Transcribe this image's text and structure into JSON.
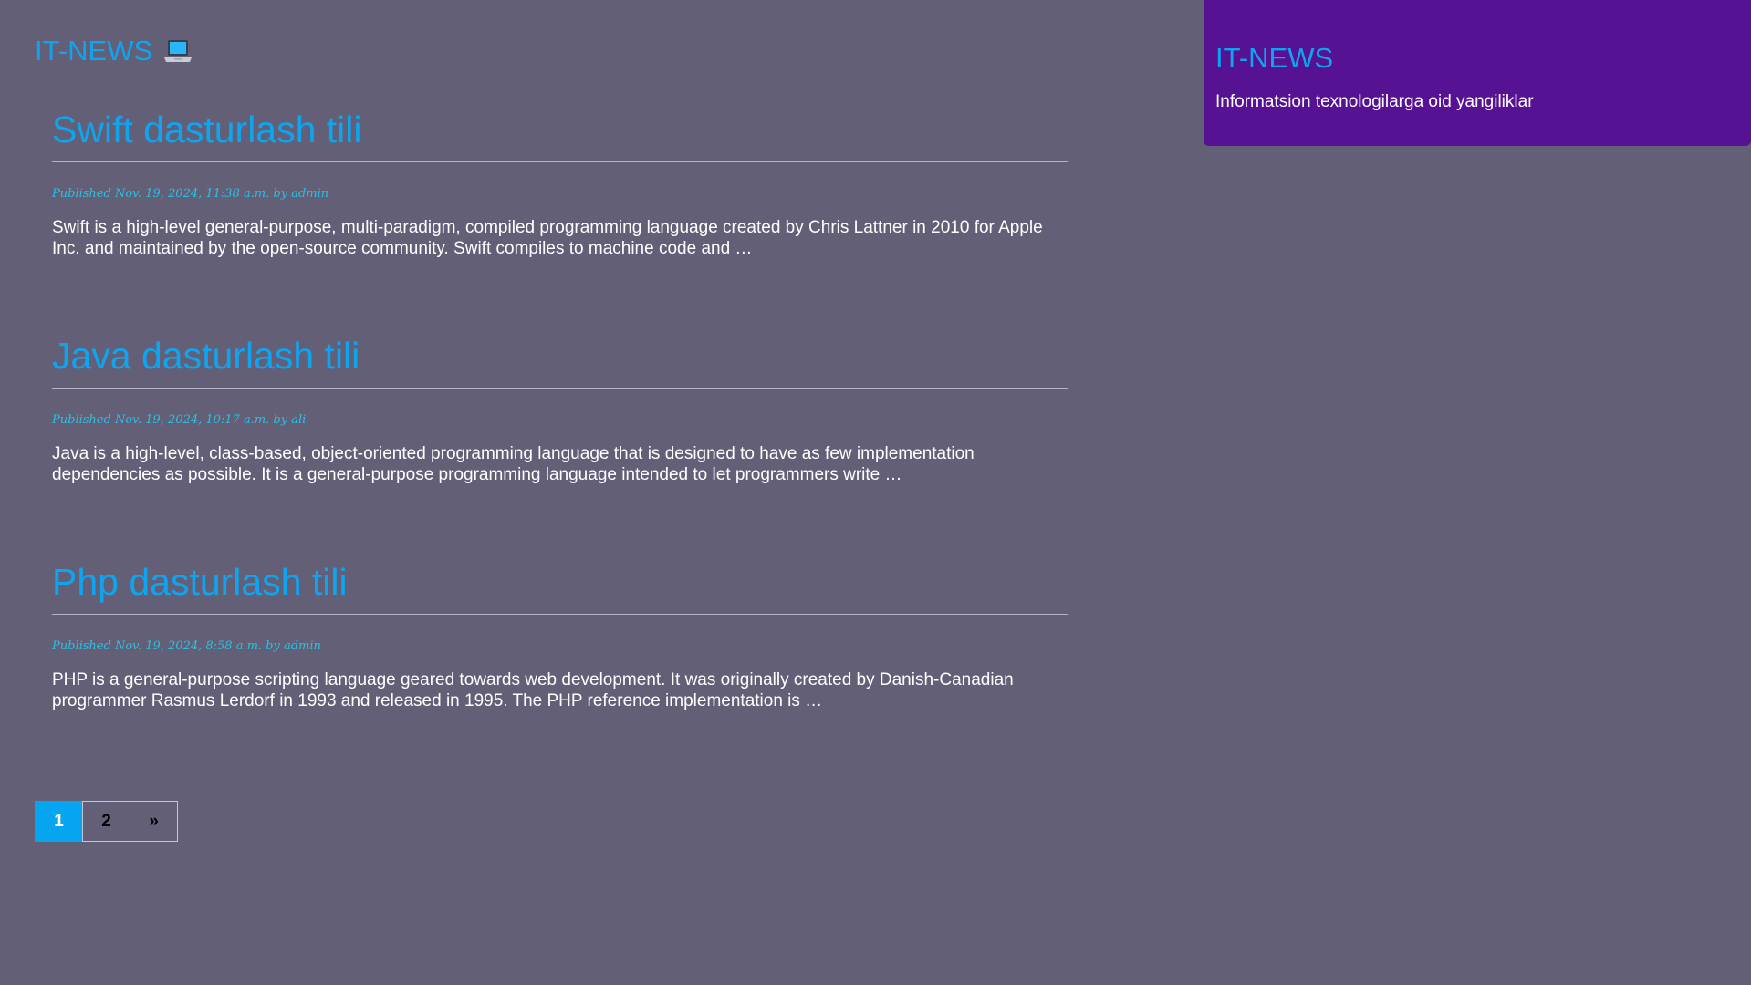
{
  "header": {
    "site_title": "IT-NEWS",
    "logo_icon": "laptop-icon"
  },
  "posts": [
    {
      "title": "Swift dasturlash tili",
      "meta": "Published Nov. 19, 2024, 11:38 a.m. by admin",
      "excerpt": "Swift is a high-level general-purpose, multi-paradigm, compiled programming language created by Chris Lattner in 2010 for Apple Inc. and maintained by the open-source community. Swift compiles to machine code and …"
    },
    {
      "title": "Java dasturlash tili",
      "meta": "Published Nov. 19, 2024, 10:17 a.m. by ali",
      "excerpt": "Java is a high-level, class-based, object-oriented programming language that is designed to have as few implementation dependencies as possible. It is a general-purpose programming language intended to let programmers write …"
    },
    {
      "title": "Php dasturlash tili",
      "meta": "Published Nov. 19, 2024, 8:58 a.m. by admin",
      "excerpt": "PHP is a general-purpose scripting language geared towards web development. It was originally created by Danish-Canadian programmer Rasmus Lerdorf in 1993 and released in 1995. The PHP reference implementation is …"
    }
  ],
  "pagination": {
    "current": "1",
    "page_2": "2",
    "next": "»"
  },
  "sidebar": {
    "title": "IT-NEWS",
    "description": "Informatsion texnologilarga oid yangiliklar"
  },
  "colors": {
    "background": "#635f77",
    "accent": "#0ea5f0",
    "meta": "#29c0e2",
    "panel": "#571293",
    "active_page": "#06a5ef"
  }
}
